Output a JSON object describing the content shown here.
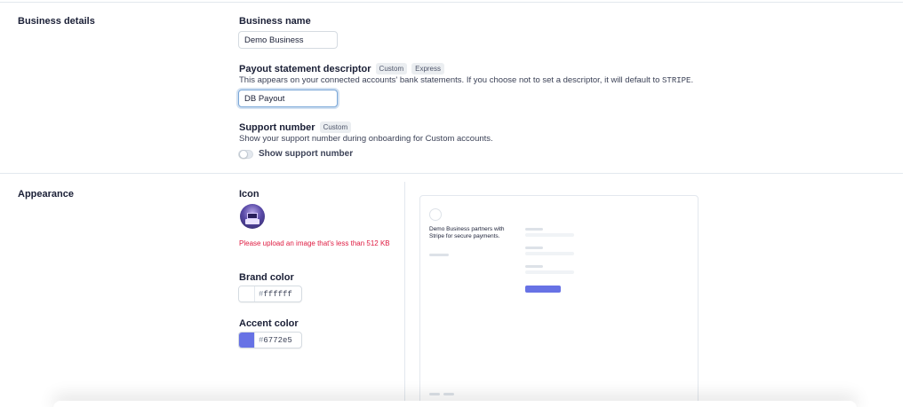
{
  "business_details": {
    "section_title": "Business details",
    "business_name": {
      "label": "Business name",
      "value": "Demo Business"
    },
    "payout_descriptor": {
      "label": "Payout statement descriptor",
      "tags": [
        "Custom",
        "Express"
      ],
      "help_text": "This appears on your connected accounts' bank statements. If you choose not to set a descriptor, it will default to ",
      "default_value": "STRIPE",
      "help_suffix": ".",
      "value": "DB Payout"
    },
    "support_number": {
      "label": "Support number",
      "tags": [
        "Custom"
      ],
      "help_text": "Show your support number during onboarding for Custom accounts.",
      "toggle_label": "Show support number",
      "toggle_on": false
    }
  },
  "appearance": {
    "section_title": "Appearance",
    "icon": {
      "label": "Icon",
      "error": "Please upload an image that's less than 512 KB"
    },
    "brand_color": {
      "label": "Brand color",
      "hash": "#",
      "hex": "ffffff",
      "color": "#ffffff"
    },
    "accent_color": {
      "label": "Accent color",
      "hash": "#",
      "hex": "6772e5",
      "color": "#6772e5"
    },
    "preview": {
      "tagline": "Demo Business partners with Stripe for secure payments."
    }
  }
}
